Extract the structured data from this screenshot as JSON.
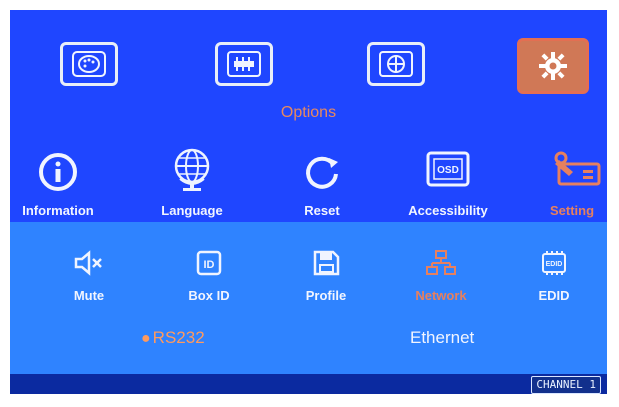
{
  "top_menu": {
    "active_index": 3,
    "icons": [
      {
        "name": "palette-icon"
      },
      {
        "name": "slider-icon"
      },
      {
        "name": "globe-icon"
      },
      {
        "name": "gear-icon"
      }
    ]
  },
  "options_title": "Options",
  "categories": [
    {
      "label": "Information",
      "icon": "info-icon"
    },
    {
      "label": "Language",
      "icon": "globe-icon"
    },
    {
      "label": "Reset",
      "icon": "refresh-icon"
    },
    {
      "label": "Accessibility",
      "icon": "osd-icon"
    },
    {
      "label": "Setting",
      "icon": "tools-icon",
      "active": true
    }
  ],
  "submenu": [
    {
      "label": "Mute",
      "icon": "mute-icon"
    },
    {
      "label": "Box ID",
      "icon": "id-icon"
    },
    {
      "label": "Profile",
      "icon": "save-icon"
    },
    {
      "label": "Network",
      "icon": "network-icon",
      "active": true
    },
    {
      "label": "EDID",
      "icon": "edid-icon"
    }
  ],
  "network_options": [
    {
      "label": "RS232",
      "selected": true
    },
    {
      "label": "Ethernet",
      "selected": false
    }
  ],
  "status": {
    "channel_label": "CHANNEL 1"
  },
  "osd_icon_text": "OSD",
  "id_icon_text": "ID",
  "edid_icon_text": "EDID",
  "colors": {
    "accent": "#e6805f",
    "panel_top": "#1f46ff",
    "panel_bottom": "#2f83ff"
  }
}
